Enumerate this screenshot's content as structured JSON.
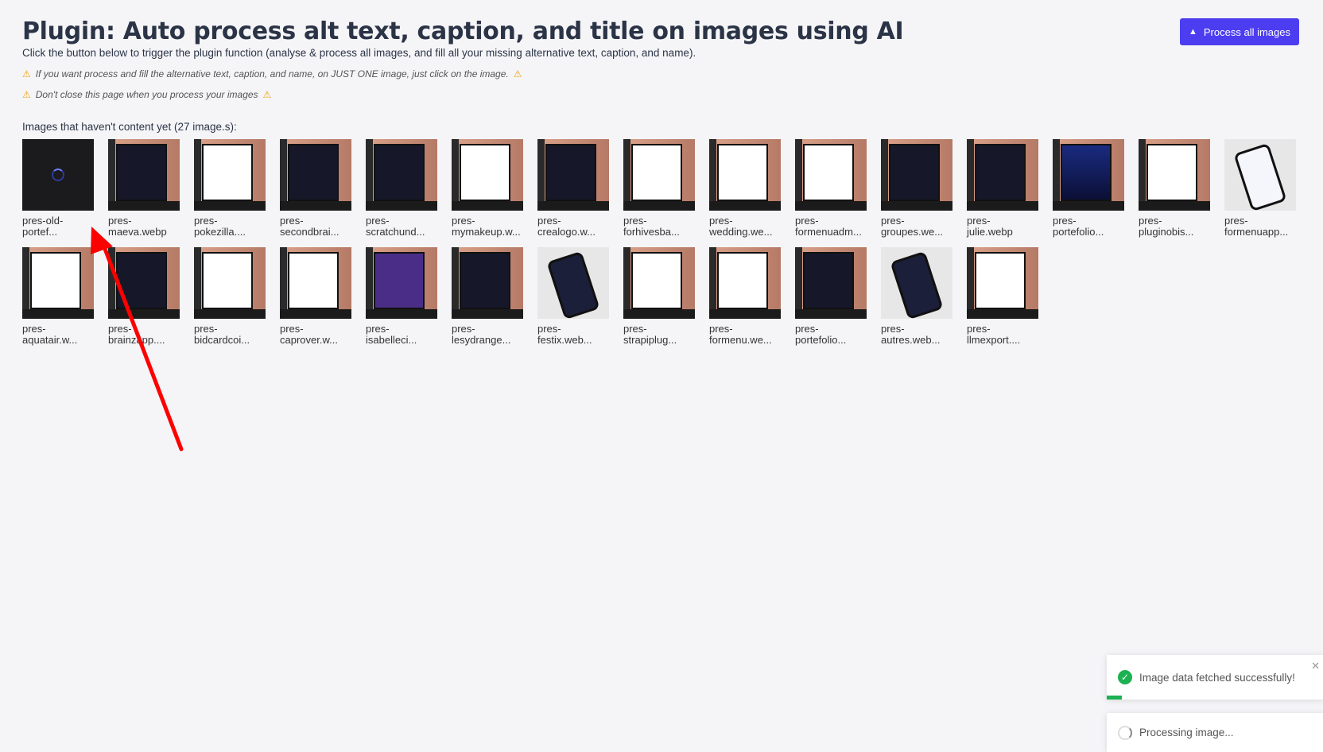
{
  "header": {
    "title": "Plugin: Auto process alt text, caption, and title on images using AI",
    "intro": "Click the button below to trigger the plugin function (analyse & process all images, and fill all your missing alternative text, caption, and name).",
    "warning_1": "If you want process and fill the alternative text, caption, and name, on JUST ONE image, just click on the image.",
    "warning_2": "Don't close this page when you process your images",
    "process_button": "Process all images"
  },
  "images_section": {
    "count_label": "Images that haven't content yet (27 image.s):",
    "items": [
      {
        "label": "pres-old-\nportef...",
        "style": "loading"
      },
      {
        "label": "pres-\nmaeva.webp",
        "style": "dark"
      },
      {
        "label": "pres-\npokezilla....",
        "style": "light"
      },
      {
        "label": "pres-\nsecondbrai...",
        "style": "dark"
      },
      {
        "label": "pres-\nscratchund...",
        "style": "dark"
      },
      {
        "label": "pres-\nmymakeup.w...",
        "style": "light"
      },
      {
        "label": "pres-\ncrealogo.w...",
        "style": "dark"
      },
      {
        "label": "pres-\nforhivesba...",
        "style": "light"
      },
      {
        "label": "pres-\nwedding.we...",
        "style": "light"
      },
      {
        "label": "pres-\nformenuadm...",
        "style": "light"
      },
      {
        "label": "pres-\ngroupes.we...",
        "style": "dark"
      },
      {
        "label": "pres-\njulie.webp",
        "style": "dark"
      },
      {
        "label": "pres-\nportefolio...",
        "style": "blue"
      },
      {
        "label": "pres-\npluginobis...",
        "style": "light"
      },
      {
        "label": "pres-\nformenuapp...",
        "style": "phone-light"
      },
      {
        "label": "pres-\naquatair.w...",
        "style": "light"
      },
      {
        "label": "pres-\nbrainzapp....",
        "style": "dark"
      },
      {
        "label": "pres-\nbidcardcoi...",
        "style": "light"
      },
      {
        "label": "pres-\ncaprover.w...",
        "style": "light"
      },
      {
        "label": "pres-\nisabelleci...",
        "style": "purple"
      },
      {
        "label": "pres-\nlesydrange...",
        "style": "dark"
      },
      {
        "label": "pres-\nfestix.web...",
        "style": "phone"
      },
      {
        "label": "pres-\nstrapiplug...",
        "style": "light"
      },
      {
        "label": "pres-\nformenu.we...",
        "style": "light"
      },
      {
        "label": "pres-\nportefolio...",
        "style": "dark"
      },
      {
        "label": "pres-\nautres.web...",
        "style": "phone"
      },
      {
        "label": "pres-\nllmexport....",
        "style": "light"
      }
    ]
  },
  "toasts": {
    "success_text": "Image data fetched successfully!",
    "success_progress": 0.07,
    "loading_text": "Processing image..."
  },
  "colors": {
    "accent": "#4c3df0",
    "success": "#1cb151",
    "annotation_arrow": "#ff0000"
  }
}
